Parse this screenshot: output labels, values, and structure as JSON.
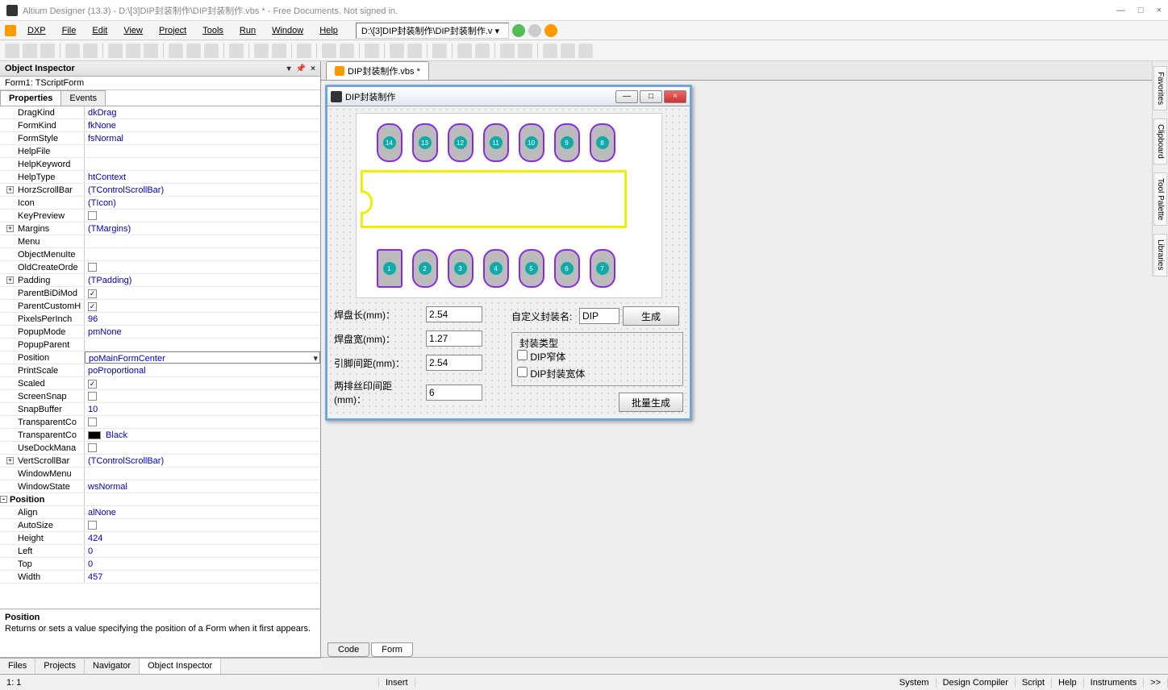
{
  "window": {
    "title": "Altium Designer (13.3) - D:\\[3]DIP封装制作\\DIP封装制作.vbs * - Free Documents. Not signed in.",
    "min": "—",
    "max": "□",
    "close": "×"
  },
  "menu": {
    "dxp": "DXP",
    "items": [
      "File",
      "Edit",
      "View",
      "Project",
      "Tools",
      "Run",
      "Window",
      "Help"
    ],
    "breadcrumb": "D:\\[3]DIP封装制作\\DIP封装制作.v ▾"
  },
  "inspector": {
    "title": "Object Inspector",
    "form": "Form1: TScriptForm",
    "tab_props": "Properties",
    "tab_events": "Events",
    "props": [
      {
        "n": "DragKind",
        "v": "dkDrag"
      },
      {
        "n": "FormKind",
        "v": "fkNone"
      },
      {
        "n": "FormStyle",
        "v": "fsNormal"
      },
      {
        "n": "HelpFile",
        "v": ""
      },
      {
        "n": "HelpKeyword",
        "v": ""
      },
      {
        "n": "HelpType",
        "v": "htContext"
      },
      {
        "n": "HorzScrollBar",
        "v": "(TControlScrollBar)",
        "exp": "+"
      },
      {
        "n": "Icon",
        "v": "(TIcon)"
      },
      {
        "n": "KeyPreview",
        "v": "",
        "chk": false
      },
      {
        "n": "Margins",
        "v": "(TMargins)",
        "exp": "+"
      },
      {
        "n": "Menu",
        "v": ""
      },
      {
        "n": "ObjectMenuIte",
        "v": ""
      },
      {
        "n": "OldCreateOrde",
        "v": "",
        "chk": false
      },
      {
        "n": "Padding",
        "v": "(TPadding)",
        "exp": "+"
      },
      {
        "n": "ParentBiDiMod",
        "v": "",
        "chk": true
      },
      {
        "n": "ParentCustomH",
        "v": "",
        "chk": true
      },
      {
        "n": "PixelsPerInch",
        "v": "96"
      },
      {
        "n": "PopupMode",
        "v": "pmNone"
      },
      {
        "n": "PopupParent",
        "v": ""
      },
      {
        "n": "Position",
        "v": "poMainFormCenter",
        "sel": true
      },
      {
        "n": "PrintScale",
        "v": "poProportional"
      },
      {
        "n": "Scaled",
        "v": "",
        "chk": true
      },
      {
        "n": "ScreenSnap",
        "v": "",
        "chk": false
      },
      {
        "n": "SnapBuffer",
        "v": "10"
      },
      {
        "n": "TransparentCo",
        "v": "",
        "chk": false
      },
      {
        "n": "TransparentCo",
        "v": "Black",
        "color": "#000"
      },
      {
        "n": "UseDockMana",
        "v": "",
        "chk": false
      },
      {
        "n": "VertScrollBar",
        "v": "(TControlScrollBar)",
        "exp": "+"
      },
      {
        "n": "WindowMenu",
        "v": ""
      },
      {
        "n": "WindowState",
        "v": "wsNormal"
      }
    ],
    "group_pos": "Position",
    "pos_props": [
      {
        "n": "Align",
        "v": "alNone"
      },
      {
        "n": "AutoSize",
        "v": "",
        "chk": false
      },
      {
        "n": "Height",
        "v": "424"
      },
      {
        "n": "Left",
        "v": "0"
      },
      {
        "n": "Top",
        "v": "0"
      },
      {
        "n": "Width",
        "v": "457"
      }
    ],
    "desc_title": "Position",
    "desc_body": "Returns or sets a value specifying the position of a Form when it first appears.",
    "bottom_tabs": [
      "Files",
      "Projects",
      "Navigator",
      "Object Inspector"
    ]
  },
  "doc": {
    "tab": "DIP封装制作.vbs *"
  },
  "form": {
    "title": "DIP封装制作",
    "pads_top": [
      "14",
      "13",
      "12",
      "11",
      "10",
      "9",
      "8"
    ],
    "pads_bot": [
      "1",
      "2",
      "3",
      "4",
      "5",
      "6",
      "7"
    ],
    "lbl_len": "焊盘长(mm)：",
    "val_len": "2.54",
    "lbl_wid": "焊盘宽(mm)：",
    "val_wid": "1.27",
    "lbl_gap": "引脚间距(mm)：",
    "val_gap": "2.54",
    "lbl_silk": "两排丝印间距(mm)：",
    "val_silk": "6",
    "lbl_name": "自定义封装名:",
    "val_name": "DIP",
    "btn_gen": "生成",
    "group_type": "封装类型",
    "chk_narrow": "DIP窄体",
    "chk_wide": "DIP封装宽体",
    "btn_batch": "批量生成"
  },
  "code_tabs": {
    "code": "Code",
    "form": "Form"
  },
  "right_tabs": [
    "Favorites",
    "Clipboard",
    "Tool Palette",
    "Libraries"
  ],
  "status": {
    "pos": "1: 1",
    "mode": "Insert",
    "right": [
      "System",
      "Design Compiler",
      "Script",
      "Help",
      "Instruments",
      ">>"
    ]
  }
}
